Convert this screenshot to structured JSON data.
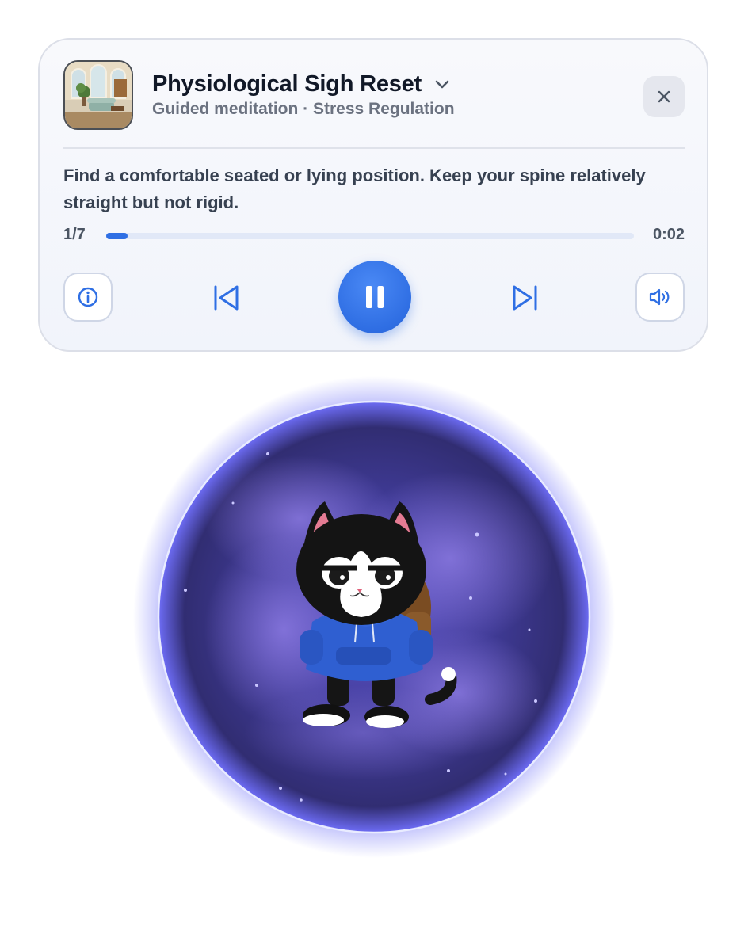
{
  "player": {
    "title": "Physiological Sigh Reset",
    "subtitle": "Guided meditation · Stress Regulation",
    "instruction": "Find a comfortable seated or lying position. Keep your spine relatively straight but not rigid.",
    "step_label": "1/7",
    "step_current": 1,
    "step_total": 7,
    "elapsed": "0:02",
    "progress_fraction": 0.04
  },
  "icons": {
    "thumbnail": "living-room-thumbnail",
    "dropdown": "chevron-down-icon",
    "close": "close-icon",
    "info": "info-icon",
    "previous": "skip-previous-icon",
    "pause": "pause-icon",
    "next": "skip-next-icon",
    "volume": "volume-icon"
  },
  "colors": {
    "accent": "#2f6fe4",
    "orb_glow": "#6d6cf5",
    "orb_dark": "#2d2a6e"
  }
}
